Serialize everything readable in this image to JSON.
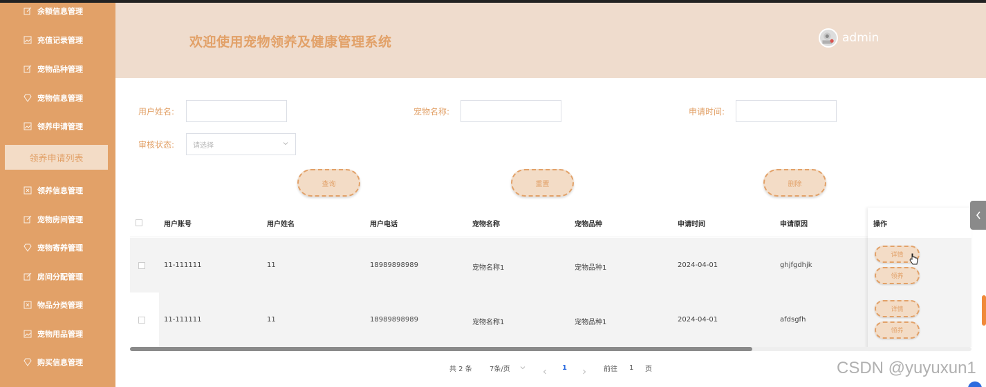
{
  "sidebar": {
    "items": [
      {
        "label": "余额信息管理",
        "icon": "edit-icon"
      },
      {
        "label": "充值记录管理",
        "icon": "image-icon"
      },
      {
        "label": "宠物品种管理",
        "icon": "edit-icon"
      },
      {
        "label": "宠物信息管理",
        "icon": "diamond-icon"
      },
      {
        "label": "领养申请管理",
        "icon": "image-icon"
      },
      {
        "label": "领养信息管理",
        "icon": "x-box-icon"
      },
      {
        "label": "宠物房间管理",
        "icon": "edit-icon"
      },
      {
        "label": "宠物寄养管理",
        "icon": "diamond-icon"
      },
      {
        "label": "房间分配管理",
        "icon": "edit-icon"
      },
      {
        "label": "物品分类管理",
        "icon": "x-box-icon"
      },
      {
        "label": "宠物用品管理",
        "icon": "image-icon"
      },
      {
        "label": "购买信息管理",
        "icon": "diamond-icon"
      }
    ],
    "active": "领养申请列表"
  },
  "header": {
    "title": "欢迎使用宠物领养及健康管理系统",
    "username": "admin"
  },
  "search": {
    "user_name_label": "用户姓名:",
    "pet_name_label": "宠物名称:",
    "apply_time_label": "申请时间:",
    "status_label": "审核状态:",
    "status_placeholder": "请选择",
    "query": "查询",
    "reset": "重置",
    "delete": "删除"
  },
  "table": {
    "headers": [
      "用户账号",
      "用户姓名",
      "用户电话",
      "宠物名称",
      "宠物品种",
      "申请时间",
      "申请原因",
      "操作"
    ],
    "rows": [
      [
        "11-111111",
        "11",
        "18989898989",
        "宠物名称1",
        "宠物品种1",
        "2024-04-01",
        "ghjfgdhjk"
      ],
      [
        "11-111111",
        "11",
        "18989898989",
        "宠物名称1",
        "宠物品种1",
        "2024-04-01",
        "afdsgfh"
      ]
    ],
    "actions": {
      "detail": "详情",
      "adopt": "领养"
    }
  },
  "pagination": {
    "total": "共 2 条",
    "page_size": "7条/页",
    "current": "1",
    "goto_prefix": "前往",
    "goto_value": "1",
    "goto_suffix": "页"
  },
  "watermark": "CSDN @yuyuxun1",
  "colors": {
    "primary": "#e2a168",
    "header_bg": "#efdccd",
    "button_bg": "#f3dcc6"
  }
}
